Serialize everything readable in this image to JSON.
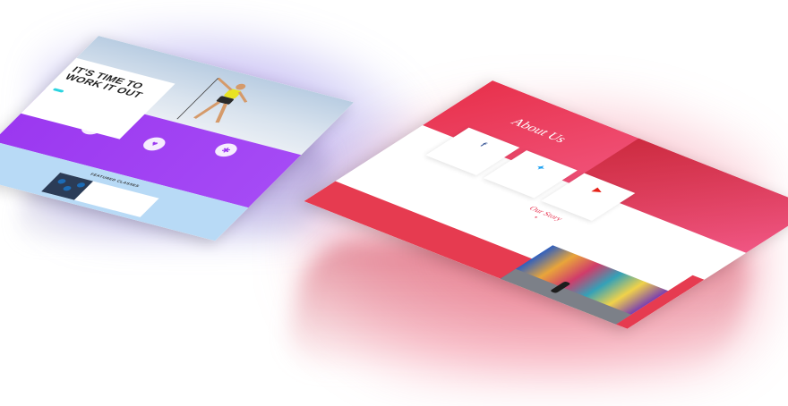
{
  "left_page": {
    "hero_title": "IT'S TIME TO WORK IT OUT",
    "hero_text": "",
    "hero_button": "",
    "features": [
      {
        "icon": "running-icon",
        "glyph": "⚡",
        "title": "",
        "text": ""
      },
      {
        "icon": "heart-icon",
        "glyph": "♥",
        "title": "",
        "text": ""
      },
      {
        "icon": "gear-icon",
        "glyph": "✱",
        "title": "",
        "text": ""
      }
    ],
    "classes_title": "FEATURED CLASSES",
    "class_card": {
      "name": "",
      "text": ""
    }
  },
  "right_page": {
    "title": "About Us",
    "subtitle": "",
    "social": [
      {
        "icon": "facebook-icon",
        "glyph": "f",
        "color": "#3b5998",
        "name": "",
        "text": ""
      },
      {
        "icon": "twitter-icon",
        "glyph": "✦",
        "color": "#1da1f2",
        "name": "",
        "text": ""
      },
      {
        "icon": "youtube-icon",
        "glyph": "▶",
        "color": "#e62117",
        "name": "",
        "text": ""
      }
    ],
    "story_title": "Our Story",
    "story_text": ""
  },
  "colors": {
    "purple": "#9b38f0",
    "cyan": "#2ad4e0",
    "light_blue": "#b8daf6",
    "coral": "#e63b50",
    "pink": "#f35a8e"
  }
}
